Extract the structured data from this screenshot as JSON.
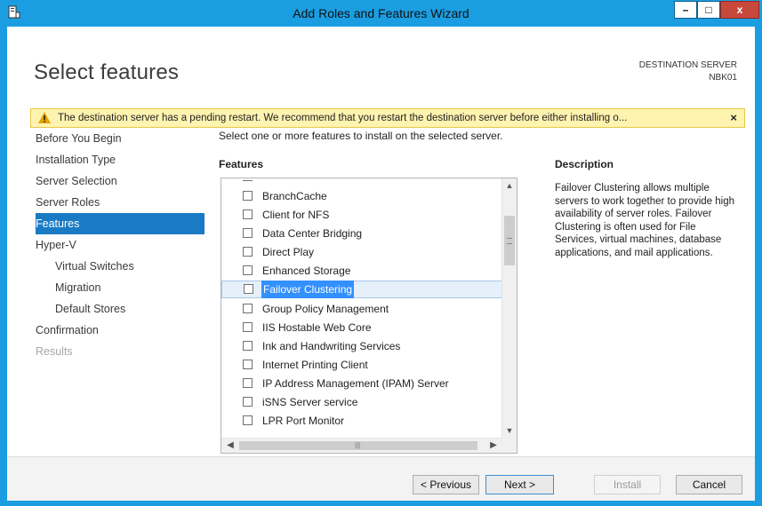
{
  "window": {
    "title": "Add Roles and Features Wizard",
    "minimize": "–",
    "maximize": "□",
    "close": "x"
  },
  "page": {
    "title": "Select features",
    "destination_label": "DESTINATION SERVER",
    "destination_name": "NBK01"
  },
  "warning": {
    "text": "The destination server has a pending restart. We recommend that you restart the destination server before either installing o...",
    "close": "×"
  },
  "nav": {
    "items": [
      {
        "label": "Before You Begin"
      },
      {
        "label": "Installation Type"
      },
      {
        "label": "Server Selection"
      },
      {
        "label": "Server Roles"
      },
      {
        "label": "Features"
      },
      {
        "label": "Hyper-V"
      },
      {
        "label": "Virtual Switches"
      },
      {
        "label": "Migration"
      },
      {
        "label": "Default Stores"
      },
      {
        "label": "Confirmation"
      },
      {
        "label": "Results"
      }
    ]
  },
  "main": {
    "instructions": "Select one or more features to install on the selected server.",
    "features_heading": "Features",
    "features": [
      {
        "label": "BranchCache"
      },
      {
        "label": "Client for NFS"
      },
      {
        "label": "Data Center Bridging"
      },
      {
        "label": "Direct Play"
      },
      {
        "label": "Enhanced Storage"
      },
      {
        "label": "Failover Clustering"
      },
      {
        "label": "Group Policy Management"
      },
      {
        "label": "IIS Hostable Web Core"
      },
      {
        "label": "Ink and Handwriting Services"
      },
      {
        "label": "Internet Printing Client"
      },
      {
        "label": "IP Address Management (IPAM) Server"
      },
      {
        "label": "iSNS Server service"
      },
      {
        "label": "LPR Port Monitor"
      }
    ],
    "description_heading": "Description",
    "description": "Failover Clustering allows multiple servers to work together to provide high availability of server roles. Failover Clustering is often used for File Services, virtual machines, database applications, and mail applications."
  },
  "footer": {
    "previous": "< Previous",
    "next": "Next >",
    "install": "Install",
    "cancel": "Cancel"
  },
  "colors": {
    "window_frame": "#1b9ee1",
    "nav_active": "#1a7bc4",
    "selection_highlight": "#3390ff",
    "warning_bg": "#fff3b0"
  }
}
